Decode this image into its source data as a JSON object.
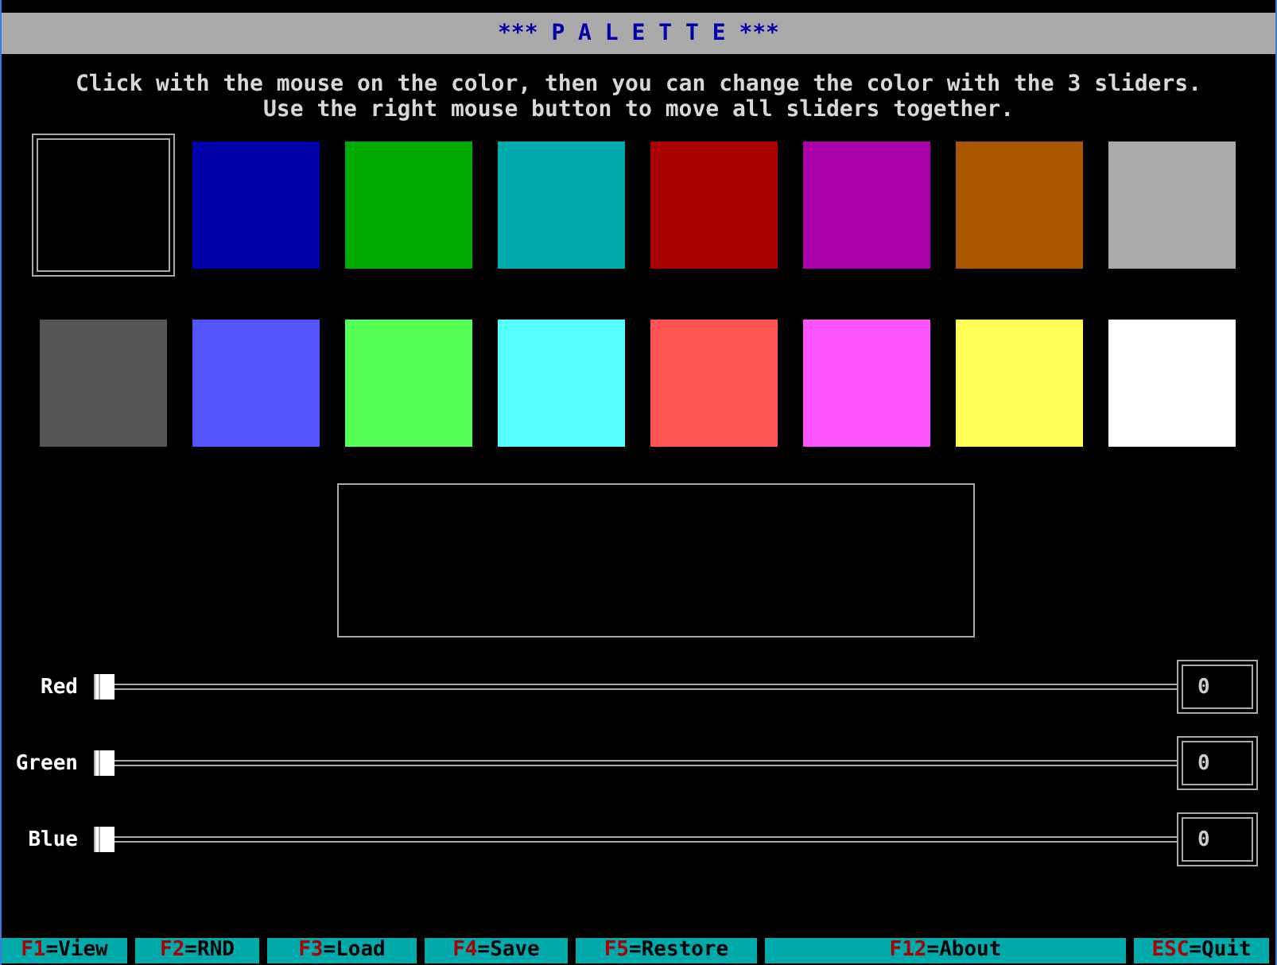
{
  "window": {
    "title": "*** P A L E T T E ***"
  },
  "instructions": [
    "Click with the mouse on the color, then you can change the color with the 3 sliders.",
    "Use the right mouse button to move all sliders together."
  ],
  "colors": [
    {
      "color": "#000000",
      "selected": true
    },
    {
      "color": "#0000aa",
      "selected": false
    },
    {
      "color": "#00aa00",
      "selected": false
    },
    {
      "color": "#00aaaa",
      "selected": false
    },
    {
      "color": "#aa0000",
      "selected": false
    },
    {
      "color": "#aa00aa",
      "selected": false
    },
    {
      "color": "#aa5500",
      "selected": false
    },
    {
      "color": "#aaaaaa",
      "selected": false
    },
    {
      "color": "#555555",
      "selected": false
    },
    {
      "color": "#5555ff",
      "selected": false
    },
    {
      "color": "#55ff55",
      "selected": false
    },
    {
      "color": "#55ffff",
      "selected": false
    },
    {
      "color": "#ff5555",
      "selected": false
    },
    {
      "color": "#ff55ff",
      "selected": false
    },
    {
      "color": "#ffff55",
      "selected": false
    },
    {
      "color": "#ffffff",
      "selected": false
    }
  ],
  "preview": {
    "color": "#000000"
  },
  "sliders": [
    {
      "label": "Red",
      "level": 0,
      "value": "0"
    },
    {
      "label": "Green",
      "level": 0,
      "value": "0"
    },
    {
      "label": "Blue",
      "level": 0,
      "value": "0"
    }
  ],
  "function_keys": [
    {
      "key": "F1",
      "label": "=View"
    },
    {
      "key": "F2",
      "label": "=RND"
    },
    {
      "key": "F3",
      "label": "=Load"
    },
    {
      "key": "F4",
      "label": "=Save"
    },
    {
      "key": "F5",
      "label": "=Restore"
    },
    {
      "key": "F12",
      "label": "=About"
    },
    {
      "key": "ESC",
      "label": "=Quit"
    }
  ]
}
